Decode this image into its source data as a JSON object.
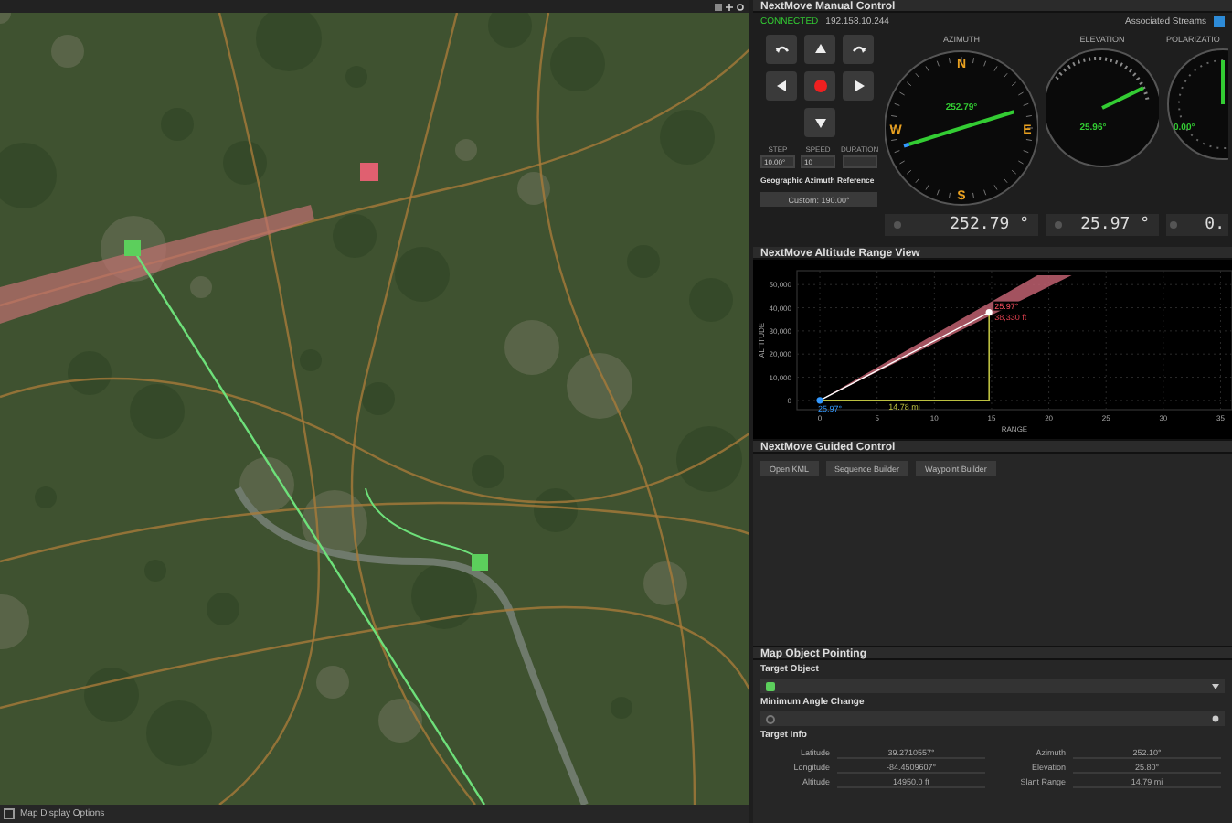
{
  "map": {
    "bottom_tab": "Map Display Options"
  },
  "manual_control": {
    "title": "NextMove Manual Control",
    "status": "CONNECTED",
    "address": "192.158.10.244",
    "associated_streams": {
      "label": "Associated Streams",
      "checked": true
    },
    "fields": [
      {
        "label": "STEP",
        "value": "10.00°"
      },
      {
        "label": "SPEED",
        "value": "10"
      },
      {
        "label": "DURATION"
      }
    ],
    "reference_label": "Geographic Azimuth Reference",
    "reference_button": "Custom: 190.00°",
    "gauges": [
      {
        "kind": "compass",
        "title": "AZIMUTH",
        "center": "252.79°",
        "readout": "252.79 °",
        "cardinals": [
          "N",
          "E",
          "S",
          "W"
        ]
      },
      {
        "kind": "arc",
        "title": "ELEVATION",
        "center": "25.96°",
        "readout": "25.97 °"
      },
      {
        "kind": "dial",
        "title": "POLARIZATIO",
        "center": "0.00°",
        "readout": "0."
      }
    ]
  },
  "range_view": {
    "title": "NextMove Altitude Range View",
    "chart_data": {
      "type": "line",
      "xlabel": "RANGE",
      "ylabel": "ALTITUDE",
      "x": [
        0,
        14.78
      ],
      "series": [
        {
          "color": "#ffffff",
          "marker": "circle",
          "values": [
            0,
            38000
          ]
        }
      ],
      "grid": true,
      "xlim": [
        -2,
        36
      ],
      "ylim": [
        -4000,
        56000
      ],
      "xticks": [
        0,
        5,
        10,
        15,
        20,
        25,
        30,
        35
      ],
      "yticks": [
        {
          "value": 0,
          "label": "0"
        },
        {
          "value": 10000,
          "label": "10,000"
        },
        {
          "value": 20000,
          "label": "20,000"
        },
        {
          "value": 30000,
          "label": "30,000"
        },
        {
          "value": 40000,
          "label": "40,000"
        },
        {
          "value": 50000,
          "label": "50,000"
        }
      ],
      "annotations": [
        "25.97°",
        "38,330 ft",
        "14.78 mi",
        "25.97°"
      ]
    }
  },
  "guided_control": {
    "title": "NextMove Guided Control",
    "buttons": [
      "Open KML",
      "Sequence Builder",
      "Waypoint Builder"
    ]
  },
  "pointing": {
    "title": "Map Object Pointing",
    "target_label": "Target Object",
    "angle_label": "Minimum Angle Change",
    "info_label": "Target Info",
    "info": [
      {
        "label": "Latitude",
        "value": "39.2710557°"
      },
      {
        "label": "Azimuth",
        "value": "252.10°"
      },
      {
        "label": "Longitude",
        "value": "-84.4509607°"
      },
      {
        "label": "Elevation",
        "value": "25.80°"
      },
      {
        "label": "Altitude",
        "value": "14950.0 ft"
      },
      {
        "label": "Slant Range",
        "value": "14.79 mi"
      }
    ]
  }
}
